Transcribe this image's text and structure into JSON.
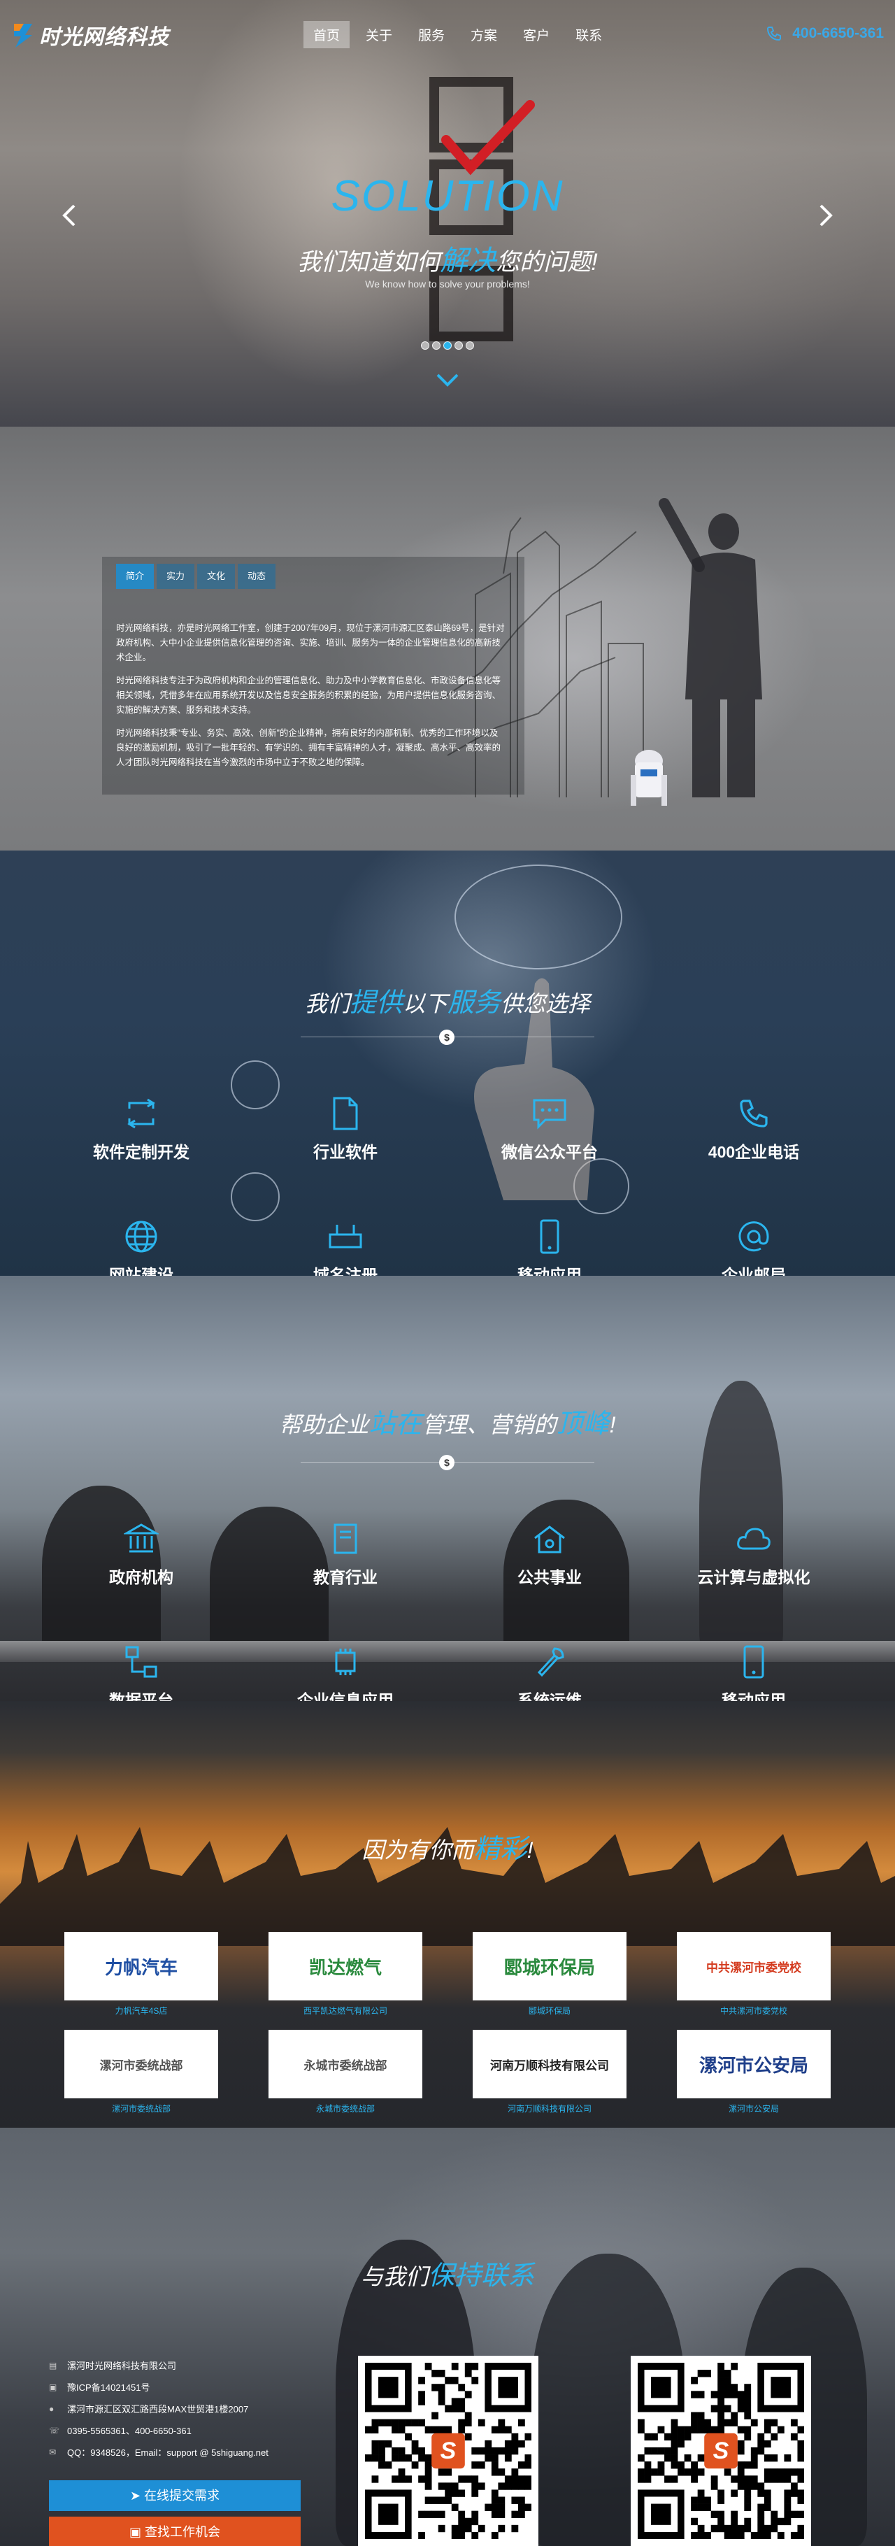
{
  "nav": {
    "logo_text": "时光网络科技",
    "items": [
      {
        "label": "首页",
        "active": true
      },
      {
        "label": "关于"
      },
      {
        "label": "服务"
      },
      {
        "label": "方案"
      },
      {
        "label": "客户"
      },
      {
        "label": "联系"
      }
    ],
    "phone": "400-6650-361"
  },
  "hero": {
    "title": "SOLUTION",
    "subtitle_pre": "我们知道如何",
    "subtitle_hl": "解决",
    "subtitle_post": "您的问题!",
    "subtitle_en": "We know how to solve your problems!",
    "slide_count": 5,
    "active_slide": 3
  },
  "about": {
    "tabs": [
      {
        "label": "简介",
        "active": true
      },
      {
        "label": "实力"
      },
      {
        "label": "文化"
      },
      {
        "label": "动态"
      }
    ],
    "paragraphs": [
      "时光网络科技，亦是时光网络工作室，创建于2007年09月，现位于漯河市源汇区泰山路69号，是针对政府机构、大中小企业提供信息化管理的咨询、实施、培训、服务为一体的企业管理信息化的高新技术企业。",
      "时光网络科技专注于为政府机构和企业的管理信息化、助力及中小学教育信息化、市政设备信息化等相关领域，凭借多年在应用系统开发以及信息安全服务的积累的经验，为用户提供信息化服务咨询、实施的解决方案、服务和技术支持。",
      "时光网络科技秉\"专业、务实、高效、创新\"的企业精神，拥有良好的内部机制、优秀的工作环境以及良好的激励机制，吸引了一批年轻的、有学识的、拥有丰富精神的人才，凝聚成、高水平、高效率的人才团队时光网络科技在当今激烈的市场中立于不败之地的保障。"
    ]
  },
  "services": {
    "title_pre": "我们",
    "title_hl1": "提供",
    "title_mid": "以下",
    "title_hl2": "服务",
    "title_post": "供您选择",
    "badge": "$",
    "items": [
      {
        "label": "软件定制开发",
        "icon": "refresh-icon"
      },
      {
        "label": "行业软件",
        "icon": "document-icon"
      },
      {
        "label": "微信公众平台",
        "icon": "chat-icon"
      },
      {
        "label": "400企业电话",
        "icon": "phone-icon"
      },
      {
        "label": "网站建设",
        "icon": "globe-icon"
      },
      {
        "label": "域名注册",
        "icon": "router-icon"
      },
      {
        "label": "移动应用",
        "icon": "mobile-icon"
      },
      {
        "label": "企业邮局",
        "icon": "at-icon"
      }
    ]
  },
  "industries": {
    "title_pre": "帮助企业",
    "title_hl1": "站在",
    "title_mid": "管理、营销的",
    "title_hl2": "顶峰",
    "title_post": "!",
    "badge": "$",
    "items": [
      {
        "label": "政府机构",
        "icon": "building-icon"
      },
      {
        "label": "教育行业",
        "icon": "book-icon"
      },
      {
        "label": "公共事业",
        "icon": "house-icon"
      },
      {
        "label": "云计算与虚拟化",
        "icon": "cloud-icon"
      },
      {
        "label": "数据平台",
        "icon": "network-icon"
      },
      {
        "label": "企业信息应用",
        "icon": "chip-icon"
      },
      {
        "label": "系统运维",
        "icon": "wrench-icon"
      },
      {
        "label": "移动应用",
        "icon": "tablet-icon"
      }
    ]
  },
  "partners": {
    "title_pre": "因为有你而",
    "title_hl": "精彩",
    "title_post": "!",
    "items": [
      {
        "logo": "力帆汽车",
        "caption": "力帆汽车4S店",
        "color": "#1f4fa3"
      },
      {
        "logo": "凯达燃气",
        "caption": "西平凯达燃气有限公司",
        "color": "#2b8a3e"
      },
      {
        "logo": "郾城环保局",
        "caption": "郾城环保局",
        "color": "#2b8a3e"
      },
      {
        "logo": "中共漯河市委党校",
        "caption": "中共漯河市委党校",
        "color": "#d43b1f"
      },
      {
        "logo": "漯河市委统战部",
        "caption": "漯河市委统战部",
        "color": "#555555"
      },
      {
        "logo": "永城市委统战部",
        "caption": "永城市委统战部",
        "color": "#555555"
      },
      {
        "logo": "河南万顺科技有限公司",
        "caption": "河南万顺科技有限公司",
        "color": "#222222"
      },
      {
        "logo": "漯河市公安局",
        "caption": "漯河市公安局",
        "color": "#1f3f8a"
      }
    ]
  },
  "contact": {
    "title_pre": "与我们",
    "title_hl": "保持联系",
    "lines": [
      {
        "icon": "company-icon",
        "text": "漯河时光网络科技有限公司"
      },
      {
        "icon": "license-icon",
        "text": "豫ICP备14021451号"
      },
      {
        "icon": "location-icon",
        "text": "漯河市源汇区双汇路西段MAX世贸港1楼2007"
      },
      {
        "icon": "phone-icon",
        "text": "0395-5565361、400-6650-361"
      },
      {
        "icon": "qq-icon",
        "text": "QQ：9348526，Email：support @ 5shiguang.net"
      }
    ],
    "btn_primary": "在线提交需求",
    "btn_secondary": "查找工作机会",
    "qr_center_letter": "S"
  }
}
